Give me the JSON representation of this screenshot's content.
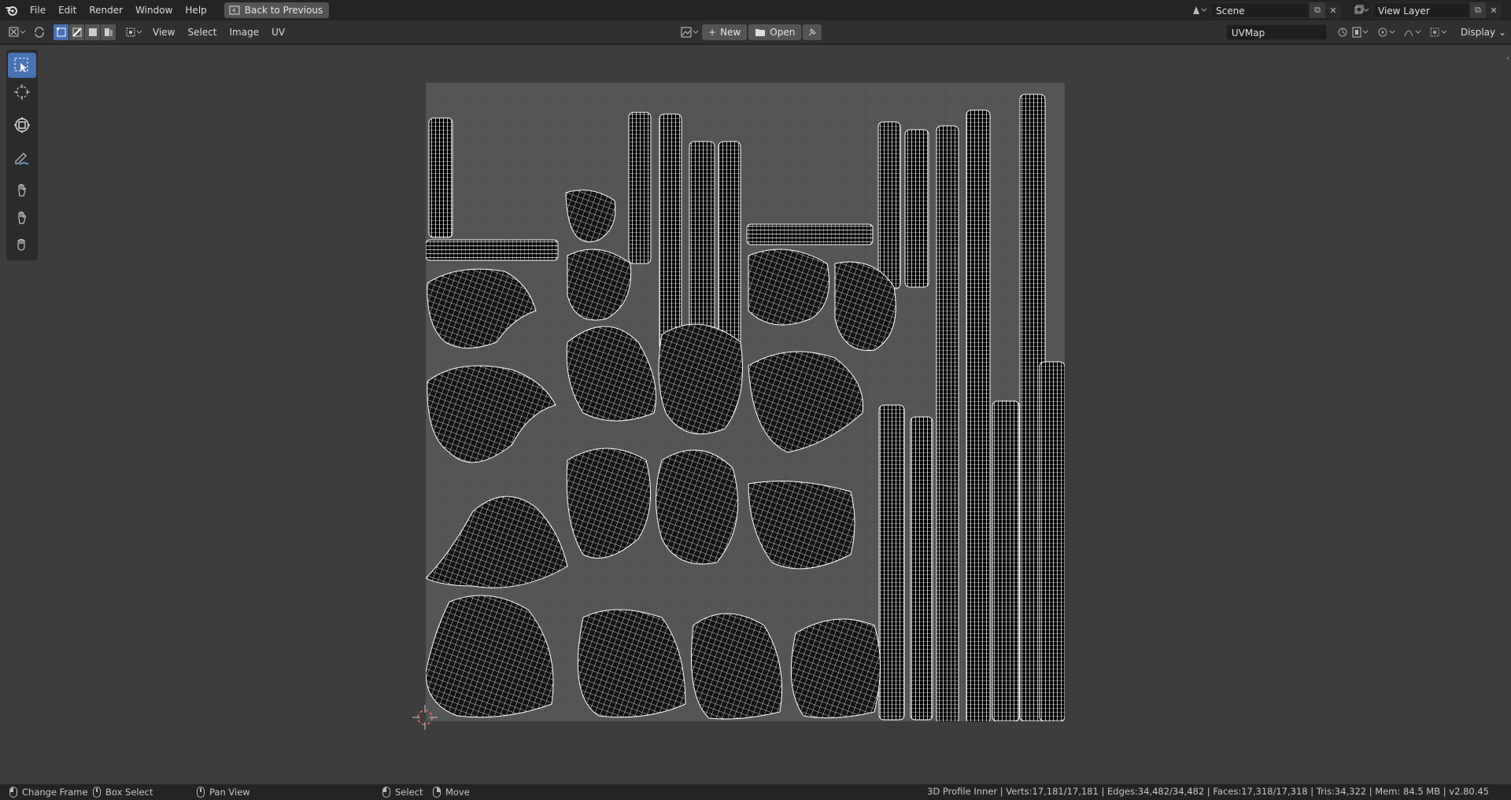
{
  "topbar": {
    "menus": [
      "File",
      "Edit",
      "Render",
      "Window",
      "Help"
    ],
    "back_button": "Back to Previous",
    "scene": "Scene",
    "view_layer": "View Layer"
  },
  "editor": {
    "menus": [
      "View",
      "Select",
      "Image",
      "UV"
    ],
    "new_label": "New",
    "open_label": "Open",
    "uvmap": "UVMap",
    "display_label": "Display"
  },
  "tools": [
    "select-box-icon",
    "cursor-icon",
    "transform-icon",
    "annotate-icon",
    "grab-icon",
    "relax-icon",
    "pinch-icon"
  ],
  "statusbar": {
    "change_frame": "Change Frame",
    "box_select": "Box Select",
    "pan_view": "Pan View",
    "select": "Select",
    "move": "Move",
    "stats": "3D Profile Inner | Verts:17,181/17,181 | Edges:34,482/34,482 | Faces:17,318/17,318 | Tris:34,322 | Mem: 84.5 MB | v2.80.45"
  },
  "colors": {
    "accent": "#4772b3",
    "uv_grid_bg": "#555555",
    "uv_wire": "#ffffff",
    "uv_fill": "#000000"
  }
}
